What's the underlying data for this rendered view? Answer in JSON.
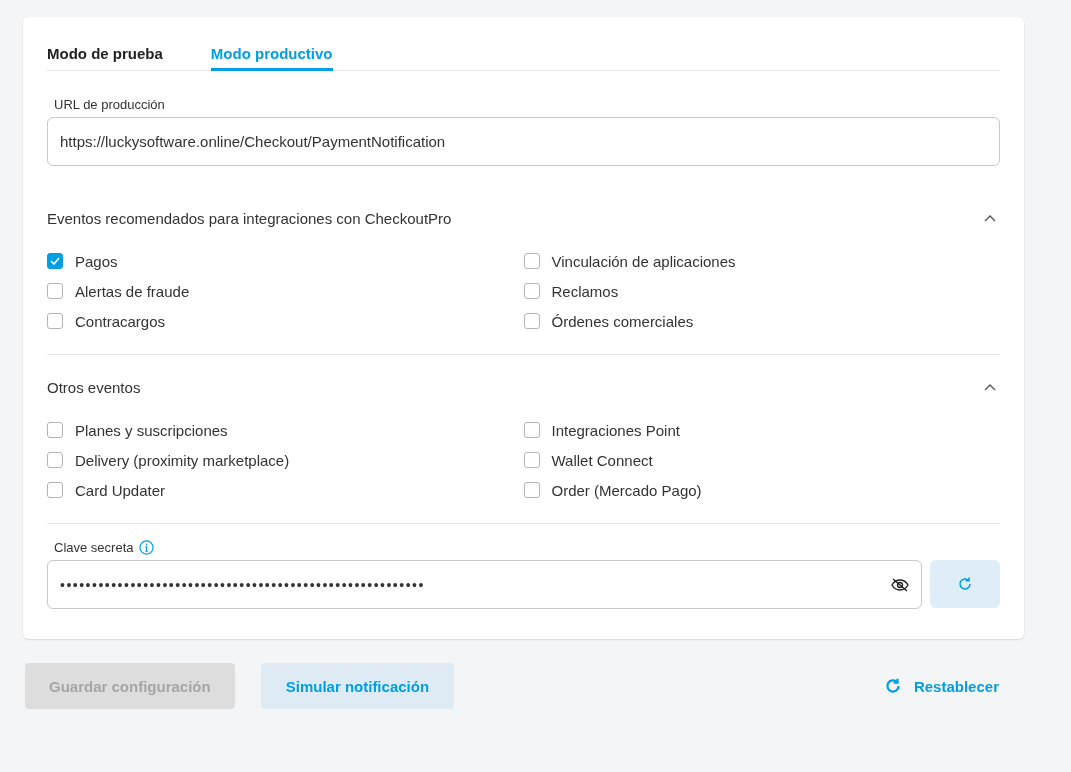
{
  "tabs": [
    {
      "label": "Modo de prueba",
      "selected": false
    },
    {
      "label": "Modo productivo",
      "selected": true
    }
  ],
  "url_field": {
    "label": "URL de producción",
    "value": "https://luckysoftware.online/Checkout/PaymentNotification"
  },
  "sections": [
    {
      "title": "Eventos recomendados para integraciones con CheckoutPro",
      "expanded": true,
      "events": [
        {
          "label": "Pagos",
          "checked": true
        },
        {
          "label": "Vinculación de aplicaciones",
          "checked": false
        },
        {
          "label": "Alertas de fraude",
          "checked": false
        },
        {
          "label": "Reclamos",
          "checked": false
        },
        {
          "label": "Contracargos",
          "checked": false
        },
        {
          "label": "Órdenes comerciales",
          "checked": false
        }
      ]
    },
    {
      "title": "Otros eventos",
      "expanded": true,
      "events": [
        {
          "label": "Planes y suscripciones",
          "checked": false
        },
        {
          "label": "Integraciones Point",
          "checked": false
        },
        {
          "label": "Delivery (proximity marketplace)",
          "checked": false
        },
        {
          "label": "Wallet Connect",
          "checked": false
        },
        {
          "label": "Card Updater",
          "checked": false
        },
        {
          "label": "Order (Mercado Pago)",
          "checked": false
        }
      ]
    }
  ],
  "secret": {
    "label": "Clave secreta",
    "value": "•••••••••••••••••••••••••••••••••••••••••••••••••••••••••"
  },
  "buttons": [
    {
      "label": "Guardar configuración",
      "disabled": true
    },
    {
      "label": "Simular notificación",
      "disabled": false
    }
  ],
  "reset": {
    "label": "Restablecer"
  }
}
